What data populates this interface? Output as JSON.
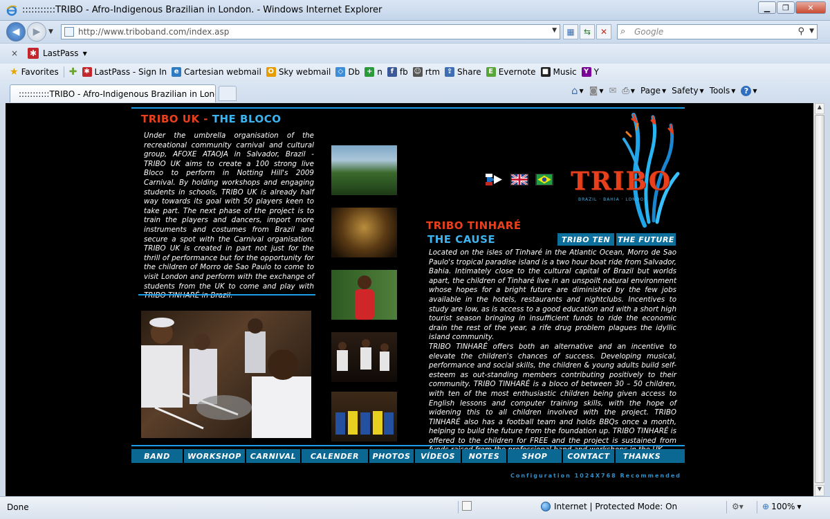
{
  "window": {
    "title": ":::::::::::TRIBO - Afro-Indigenous Brazilian in London. - Windows Internet Explorer",
    "minimize": "▁",
    "restore": "❐",
    "close": "✕"
  },
  "address_bar": {
    "url": "http://www.triboband.com/index.asp",
    "search_placeholder": "Google"
  },
  "lastpass_bar": {
    "close": "×",
    "label": "LastPass"
  },
  "favorites_bar": {
    "favorites_label": "Favorites",
    "items": [
      {
        "label": "LastPass - Sign In",
        "icon": "lastpass-icon",
        "color": "#c3262d"
      },
      {
        "label": "Cartesian webmail",
        "icon": "ie-page-icon",
        "color": "#2f7bc2"
      },
      {
        "label": "Sky webmail",
        "icon": "outlook-icon",
        "color": "#e69b00"
      },
      {
        "label": "Db",
        "icon": "dropbox-icon",
        "color": "#3d8ed6"
      },
      {
        "label": "n",
        "icon": "plus-icon",
        "color": "#2a9a3b"
      },
      {
        "label": "fb",
        "icon": "facebook-icon",
        "color": "#3b5998"
      },
      {
        "label": "rtm",
        "icon": "cow-icon",
        "color": "#555555"
      },
      {
        "label": "Share",
        "icon": "share-icon",
        "color": "#3e6fb3"
      },
      {
        "label": "Evernote",
        "icon": "evernote-icon",
        "color": "#5aa53b"
      },
      {
        "label": "Music",
        "icon": "bbc-icon",
        "color": "#222222"
      },
      {
        "label": "Y",
        "icon": "yahoo-icon",
        "color": "#7b0099"
      }
    ]
  },
  "tabs": [
    {
      "label": ":::::::::::TRIBO - Afro-Indigenous Brazilian in Lond..."
    }
  ],
  "command_bar": {
    "page": "Page",
    "safety": "Safety",
    "tools": "Tools",
    "help": "?"
  },
  "page": {
    "bloco_heading_red": "TRIBO UK -",
    "bloco_heading_blue": "THE BLOCO",
    "bloco_text": "Under the umbrella organisation of the recreational community carnival and cultural group, AFOXE ATAOJA in Salvador, Brazil - TRIBO UK aims to create a 100 strong live Bloco to perform in Notting Hill's 2009 Carnival. By holding workshops and engaging students in schools, TRIBO UK is already half way towards its goal with 50 players keen to take part. The next phase of the project is to train the players and dancers, import more instruments and costumes from Brazil and secure a spot with the Carnival organisation. TRIBO UK is created in part not just for the thrill of performance but for the opportunity for the children of Morro de Sao Paulo to come to visit London and perform with the exchange of students from the UK to come and play with TRIBO TINHARÉ in Brazil.",
    "logo_text": "TRIBO",
    "logo_sub": "BRAZIL · BAHIA · LONDON",
    "cause_heading_red": "TRIBO TINHARÉ",
    "cause_heading_blue": "THE CAUSE",
    "tab_ten": "TRIBO TEN",
    "tab_future": "THE FUTURE",
    "cause_text_1": "Located on the isles of Tinharé in the Atlantic Ocean, Morro de Sao Paulo's tropical paradise island is a two hour boat ride from Salvador, Bahia. Intimately close to the cultural capital of Brazil but worlds apart, the children of Tinharé live in an unspoilt natural environment whose hopes for a bright future are diminished by the few jobs available in the hotels, restaurants and nightclubs. Incentives to study are low, as is access to a good education and with a short high tourist season bringing in insufficient funds to ride the economic drain the rest of the year, a rife drug problem plagues the idyllic island community.",
    "cause_text_2": "TRIBO TINHARÉ offers both an alternative and an incentive to elevate the children's chances of success. Developing musical, performance and social skills, the children & young adults build self-esteem as out-standing members contributing positively to their community. TRIBO TINHARÉ is a bloco of between 30 – 50 children, with ten of the most enthusiastic children being given access to English lessons and computer training skills, with the hope of widening this to all children involved with the project. TRIBO TINHARÉ also has a football team and holds BBQs once a month, helping to build the future from the foundation up. TRIBO TINHARÉ is offered to the children for FREE and the project is sustained from funds raised from the professional band and workshops in the UK.",
    "nav": [
      "BAND",
      "WORKSHOP",
      "CARNIVAL",
      "CALENDER",
      "PHOTOS",
      "VÍDEOS",
      "NOTES",
      "SHOP",
      "CONTACT",
      "THANKS"
    ],
    "config_note": "Configuration 1024X768 Recommended"
  },
  "status_bar": {
    "status": "Done",
    "zone": "Internet | Protected Mode: On",
    "zoom": "100%"
  }
}
